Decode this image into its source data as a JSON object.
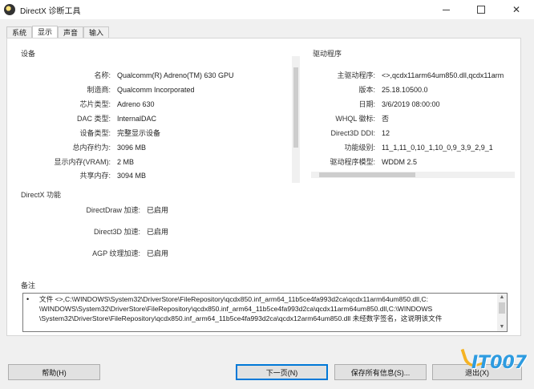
{
  "window": {
    "title": "DirectX 诊断工具",
    "app_icon": "directx-icon",
    "controls": [
      "minimize-icon",
      "maximize-icon",
      "close-icon"
    ],
    "close_glyph": "✕"
  },
  "tabs": [
    {
      "label": "系统",
      "active": false
    },
    {
      "label": "显示",
      "active": true
    },
    {
      "label": "声音",
      "active": false
    },
    {
      "label": "输入",
      "active": false
    }
  ],
  "device": {
    "group_label": "设备",
    "rows": [
      {
        "key": "名称:",
        "value": "Qualcomm(R) Adreno(TM) 630 GPU"
      },
      {
        "key": "制造商:",
        "value": "Qualcomm Incorporated"
      },
      {
        "key": "芯片类型:",
        "value": "Adreno 630"
      },
      {
        "key": "DAC 类型:",
        "value": "InternalDAC"
      },
      {
        "key": "设备类型:",
        "value": "完整显示设备"
      },
      {
        "key": "总内存约为:",
        "value": "3096 MB"
      },
      {
        "key": "显示内存(VRAM):",
        "value": "2 MB"
      },
      {
        "key": "共享内存:",
        "value": "3094 MB"
      }
    ]
  },
  "driver": {
    "group_label": "驱动程序",
    "rows": [
      {
        "key": "主驱动程序:",
        "value": "<>,qcdx11arm64um850.dll,qcdx11arm"
      },
      {
        "key": "版本:",
        "value": "25.18.10500.0"
      },
      {
        "key": "日期:",
        "value": "3/6/2019 08:00:00"
      },
      {
        "key": "WHQL 徽标:",
        "value": "否"
      },
      {
        "key": "Direct3D DDI:",
        "value": "12"
      },
      {
        "key": "功能级别:",
        "value": "11_1,11_0,10_1,10_0,9_3,9_2,9_1"
      },
      {
        "key": "驱动程序模型:",
        "value": "WDDM 2.5"
      }
    ]
  },
  "directx_features": {
    "group_label": "DirectX 功能",
    "rows": [
      {
        "key": "DirectDraw 加速:",
        "value": "已启用"
      },
      {
        "key": "Direct3D 加速:",
        "value": "已启用"
      },
      {
        "key": "AGP 纹理加速:",
        "value": "已启用"
      }
    ]
  },
  "notes": {
    "group_label": "备注",
    "bullet": "•",
    "lines": [
      "文件 <>,C:\\WINDOWS\\System32\\DriverStore\\FileRepository\\qcdx850.inf_arm64_11b5ce4fa993d2ca\\qcdx11arm64um850.dll,C:",
      "\\WINDOWS\\System32\\DriverStore\\FileRepository\\qcdx850.inf_arm64_11b5ce4fa993d2ca\\qcdx11arm64um850.dll,C:\\WINDOWS",
      "\\System32\\DriverStore\\FileRepository\\qcdx850.inf_arm64_11b5ce4fa993d2ca\\qcdx12arm64um850.dll 未经数字签名，这说明该文件"
    ],
    "scroll_up": "▲",
    "scroll_down": "▼"
  },
  "buttons": {
    "help": "帮助(H)",
    "next_page": "下一页(N)",
    "save_all": "保存所有信息(S)...",
    "exit": "退出(X)"
  },
  "watermark": "IT007"
}
